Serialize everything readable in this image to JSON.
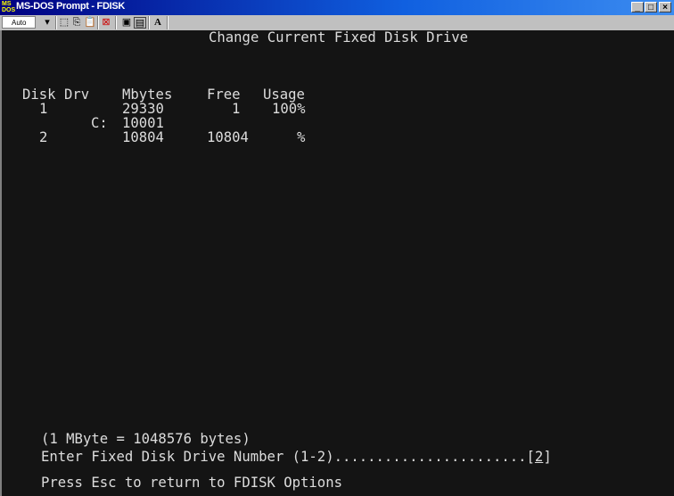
{
  "window": {
    "title": "MS-DOS Prompt - FDISK",
    "icon_text": "MS"
  },
  "toolbar": {
    "font_size": "Auto",
    "buttons": [
      "mark-icon",
      "copy-icon",
      "paste-icon",
      "fullscreen-icon",
      "properties-icon",
      "background-icon",
      "font-icon"
    ],
    "font_label": "A"
  },
  "screen": {
    "heading": "Change Current Fixed Disk Drive",
    "columns": {
      "disk": "Disk",
      "drv": "Drv",
      "mbytes": "Mbytes",
      "free": "Free",
      "usage": "Usage"
    },
    "rows": [
      {
        "disk": "1",
        "drv": "",
        "mbytes": "29330",
        "free": "1",
        "usage": "100%"
      },
      {
        "disk": "",
        "drv": "C:",
        "mbytes": "10001",
        "free": "",
        "usage": ""
      },
      {
        "disk": "2",
        "drv": "",
        "mbytes": "10804",
        "free": "10804",
        "usage": "%"
      }
    ],
    "mbyte_note": "(1 MByte = 1048576 bytes)",
    "prompt": "Enter Fixed Disk Drive Number (1-2).......................",
    "prompt_value": "2",
    "esc_hint": "Press Esc to return to FDISK Options"
  }
}
